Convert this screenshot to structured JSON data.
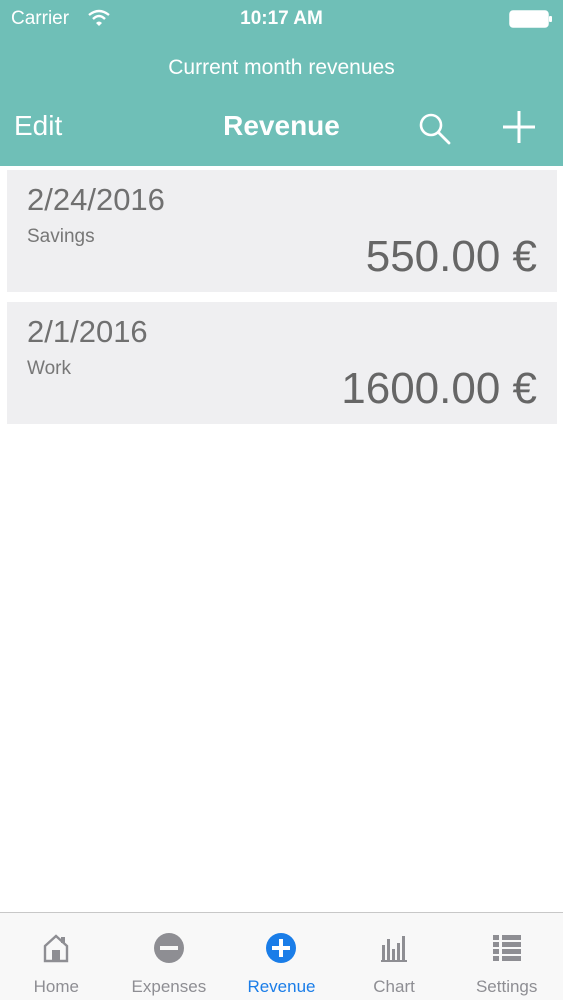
{
  "status_bar": {
    "carrier": "Carrier",
    "time": "10:17 AM"
  },
  "header": {
    "subtitle": "Current month revenues",
    "edit_label": "Edit",
    "title": "Revenue",
    "search_icon": "search-icon",
    "add_icon": "plus-icon"
  },
  "entries": [
    {
      "date": "2/24/2016",
      "category": "Savings",
      "amount": "550.00 €"
    },
    {
      "date": "2/1/2016",
      "category": "Work",
      "amount": "1600.00 €"
    }
  ],
  "tabs": [
    {
      "label": "Home",
      "icon": "home-icon",
      "active": false
    },
    {
      "label": "Expenses",
      "icon": "minus-circle-icon",
      "active": false
    },
    {
      "label": "Revenue",
      "icon": "plus-circle-icon",
      "active": true
    },
    {
      "label": "Chart",
      "icon": "bar-chart-icon",
      "active": false
    },
    {
      "label": "Settings",
      "icon": "list-icon",
      "active": false
    }
  ],
  "colors": {
    "header_bg": "#6fbfb7",
    "card_bg": "#efeff1",
    "active_tab": "#1a7de8",
    "inactive_tab": "#8e8e93"
  }
}
